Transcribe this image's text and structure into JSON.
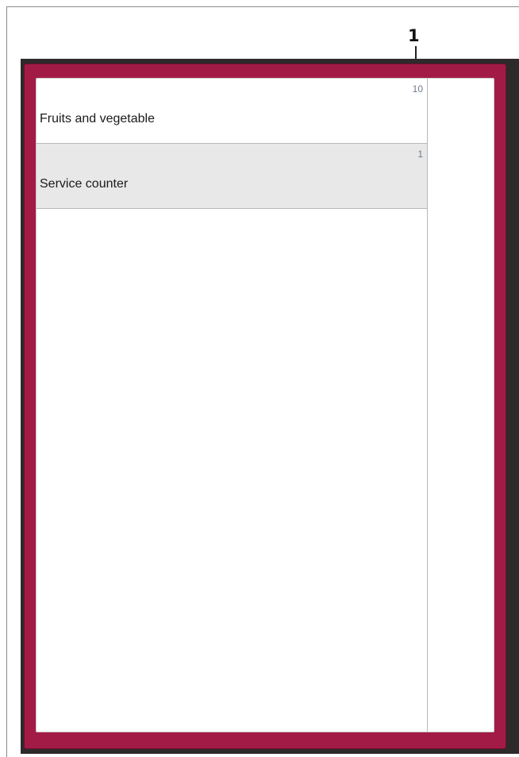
{
  "callout": {
    "number": "1"
  },
  "list": {
    "items": [
      {
        "label": "Fruits and vegetable",
        "count": "10"
      },
      {
        "label": "Service counter",
        "count": "1"
      }
    ]
  },
  "colors": {
    "frame": "#a21b46",
    "bezel": "#2e2a2b",
    "selected_row": "#e7e8e7",
    "count_text": "#6e7b8c"
  }
}
